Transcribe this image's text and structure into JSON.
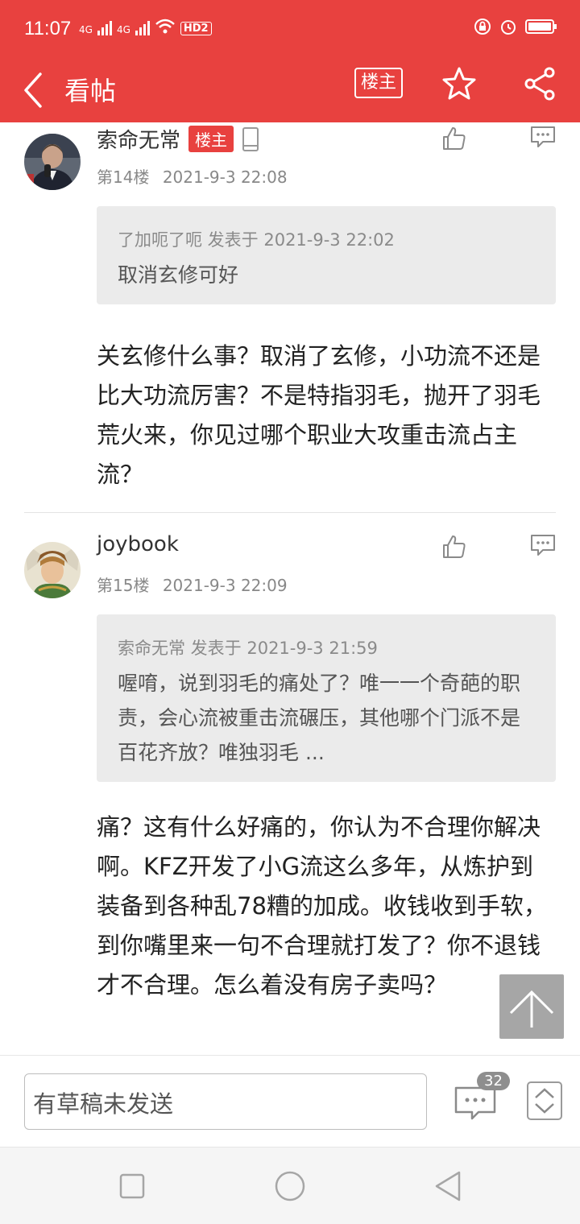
{
  "status": {
    "time": "11:07",
    "net1": "4G",
    "net2": "4G",
    "hd": "HD",
    "hd_num": "2"
  },
  "nav": {
    "title": "看帖",
    "owner_filter": "楼主"
  },
  "posts": [
    {
      "author": "索命无常",
      "badge": "楼主",
      "floor": "第14楼",
      "time": "2021-9-3 22:08",
      "quote": {
        "head": "了加呃了呃 发表于 2021-9-3 22:02",
        "body": "取消玄修可好"
      },
      "body": "关玄修什么事？取消了玄修，小功流不还是比大功流厉害？不是特指羽毛，抛开了羽毛荒火来，你见过哪个职业大攻重击流占主流？"
    },
    {
      "author": "joybook",
      "floor": "第15楼",
      "time": "2021-9-3 22:09",
      "quote": {
        "head": "索命无常 发表于 2021-9-3 21:59",
        "body": "喔唷，说到羽毛的痛处了？唯一一个奇葩的职责，会心流被重击流碾压，其他哪个门派不是百花齐放？唯独羽毛 ..."
      },
      "body": "痛？这有什么好痛的，你认为不合理你解决啊。KFZ开发了小G流这么多年，从炼护到装备到各种乱78糟的加成。收钱收到手软，到你嘴里来一句不合理就打发了？你不退钱才不合理。怎么着没有房子卖吗？"
    }
  ],
  "bottom": {
    "draft": "有草稿未发送",
    "comment_count": "32"
  },
  "colors": {
    "brand": "#e8413f"
  }
}
